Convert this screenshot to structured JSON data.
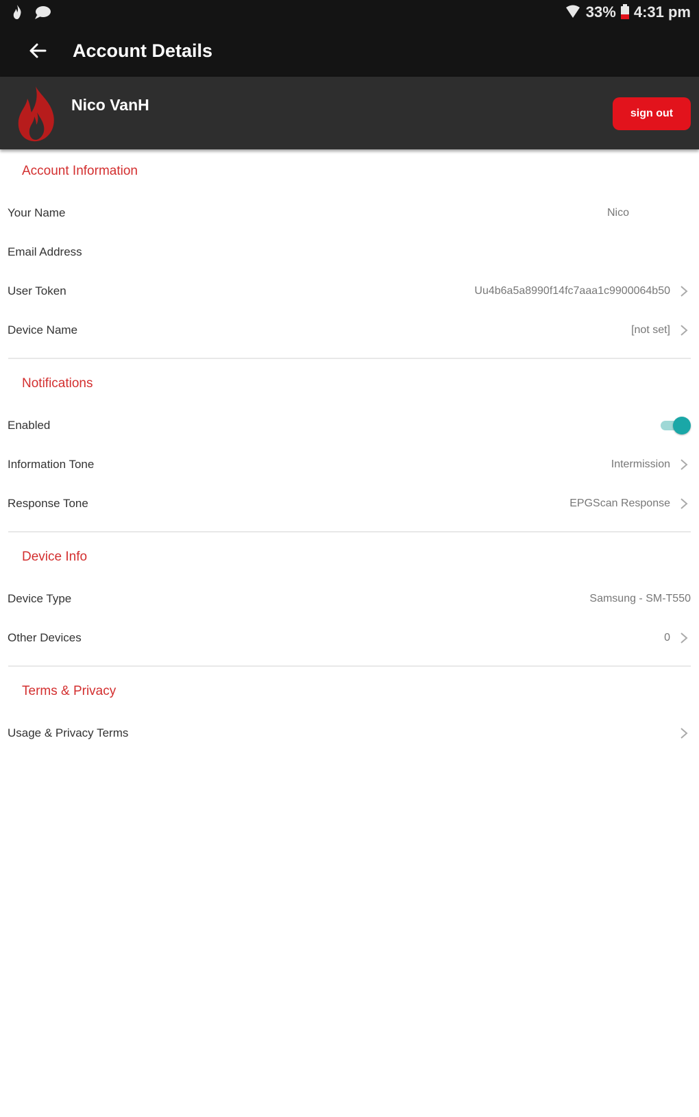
{
  "status_bar": {
    "battery": "33%",
    "time": "4:31 pm",
    "icons": [
      "fire-notification-icon",
      "chat-notification-icon",
      "wifi-icon",
      "battery-icon",
      "alert-icon"
    ]
  },
  "app_bar": {
    "title": "Account Details",
    "back_icon": "arrow-back-icon"
  },
  "profile": {
    "name": "Nico VanH",
    "sign_out_label": "sign out",
    "logo": "flame-logo"
  },
  "sections": {
    "account": {
      "header": "Account Information",
      "your_name": {
        "label": "Your Name",
        "value": "Nico"
      },
      "email": {
        "label": "Email Address",
        "value": ""
      },
      "user_token": {
        "label": "User Token",
        "value": "Uu4b6a5a8990f14fc7aaa1c9900064b50"
      },
      "device_name": {
        "label": "Device Name",
        "value": "[not set]"
      }
    },
    "notifications": {
      "header": "Notifications",
      "enabled": {
        "label": "Enabled",
        "on": true
      },
      "information_tone": {
        "label": "Information Tone",
        "value": "Intermission"
      },
      "response_tone": {
        "label": "Response Tone",
        "value": "EPGScan Response"
      }
    },
    "device_info": {
      "header": "Device Info",
      "device_type": {
        "label": "Device Type",
        "value": "Samsung - SM-T550"
      },
      "other_devices": {
        "label": "Other Devices",
        "value": "0"
      }
    },
    "terms": {
      "header": "Terms & Privacy",
      "usage_terms": {
        "label": "Usage & Privacy Terms"
      }
    }
  },
  "colors": {
    "app_bar": "#141414",
    "profile_bar": "#2e2e2e",
    "accent_red": "#d32f2f",
    "sign_out_red": "#e2131c",
    "toggle_teal": "#1aa7a7"
  }
}
